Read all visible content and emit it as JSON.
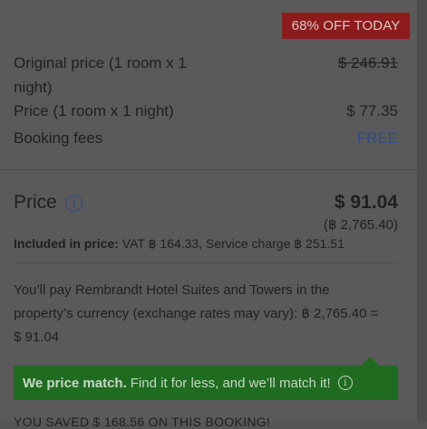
{
  "badge": {
    "text": "68% OFF TODAY"
  },
  "rows": [
    {
      "label_line1": "Original price (1 room x 1",
      "label_line2": "night)",
      "value": "$ 246.91"
    },
    {
      "label": "Price (1 room x 1 night)",
      "value": "$ 77.35"
    },
    {
      "label": "Booking fees",
      "value": "FREE"
    }
  ],
  "price": {
    "title": "Price",
    "total": "$ 91.04",
    "local": "(฿ 2,765.40)",
    "included_label": "Included in price:",
    "included_text": "VAT ฿ 164.33, Service charge ฿ 251.51"
  },
  "currency_note": {
    "line1": "You’ll pay Rembrandt Hotel Suites and Towers in the",
    "line2": "property’s currency (exchange rates may vary): ฿ 2,765.40 =",
    "line3": "$ 91.04"
  },
  "price_match": {
    "bold": "We price match.",
    "text": "Find it for less, and we’ll match it!"
  },
  "saved": {
    "text": "YOU SAVED $ 168.56 ON THIS BOOKING!"
  },
  "colors": {
    "badge": "#8e1b1b",
    "free": "#2a4c8a",
    "match": "#1f6b1f",
    "overlay": "#5a5a5a"
  }
}
